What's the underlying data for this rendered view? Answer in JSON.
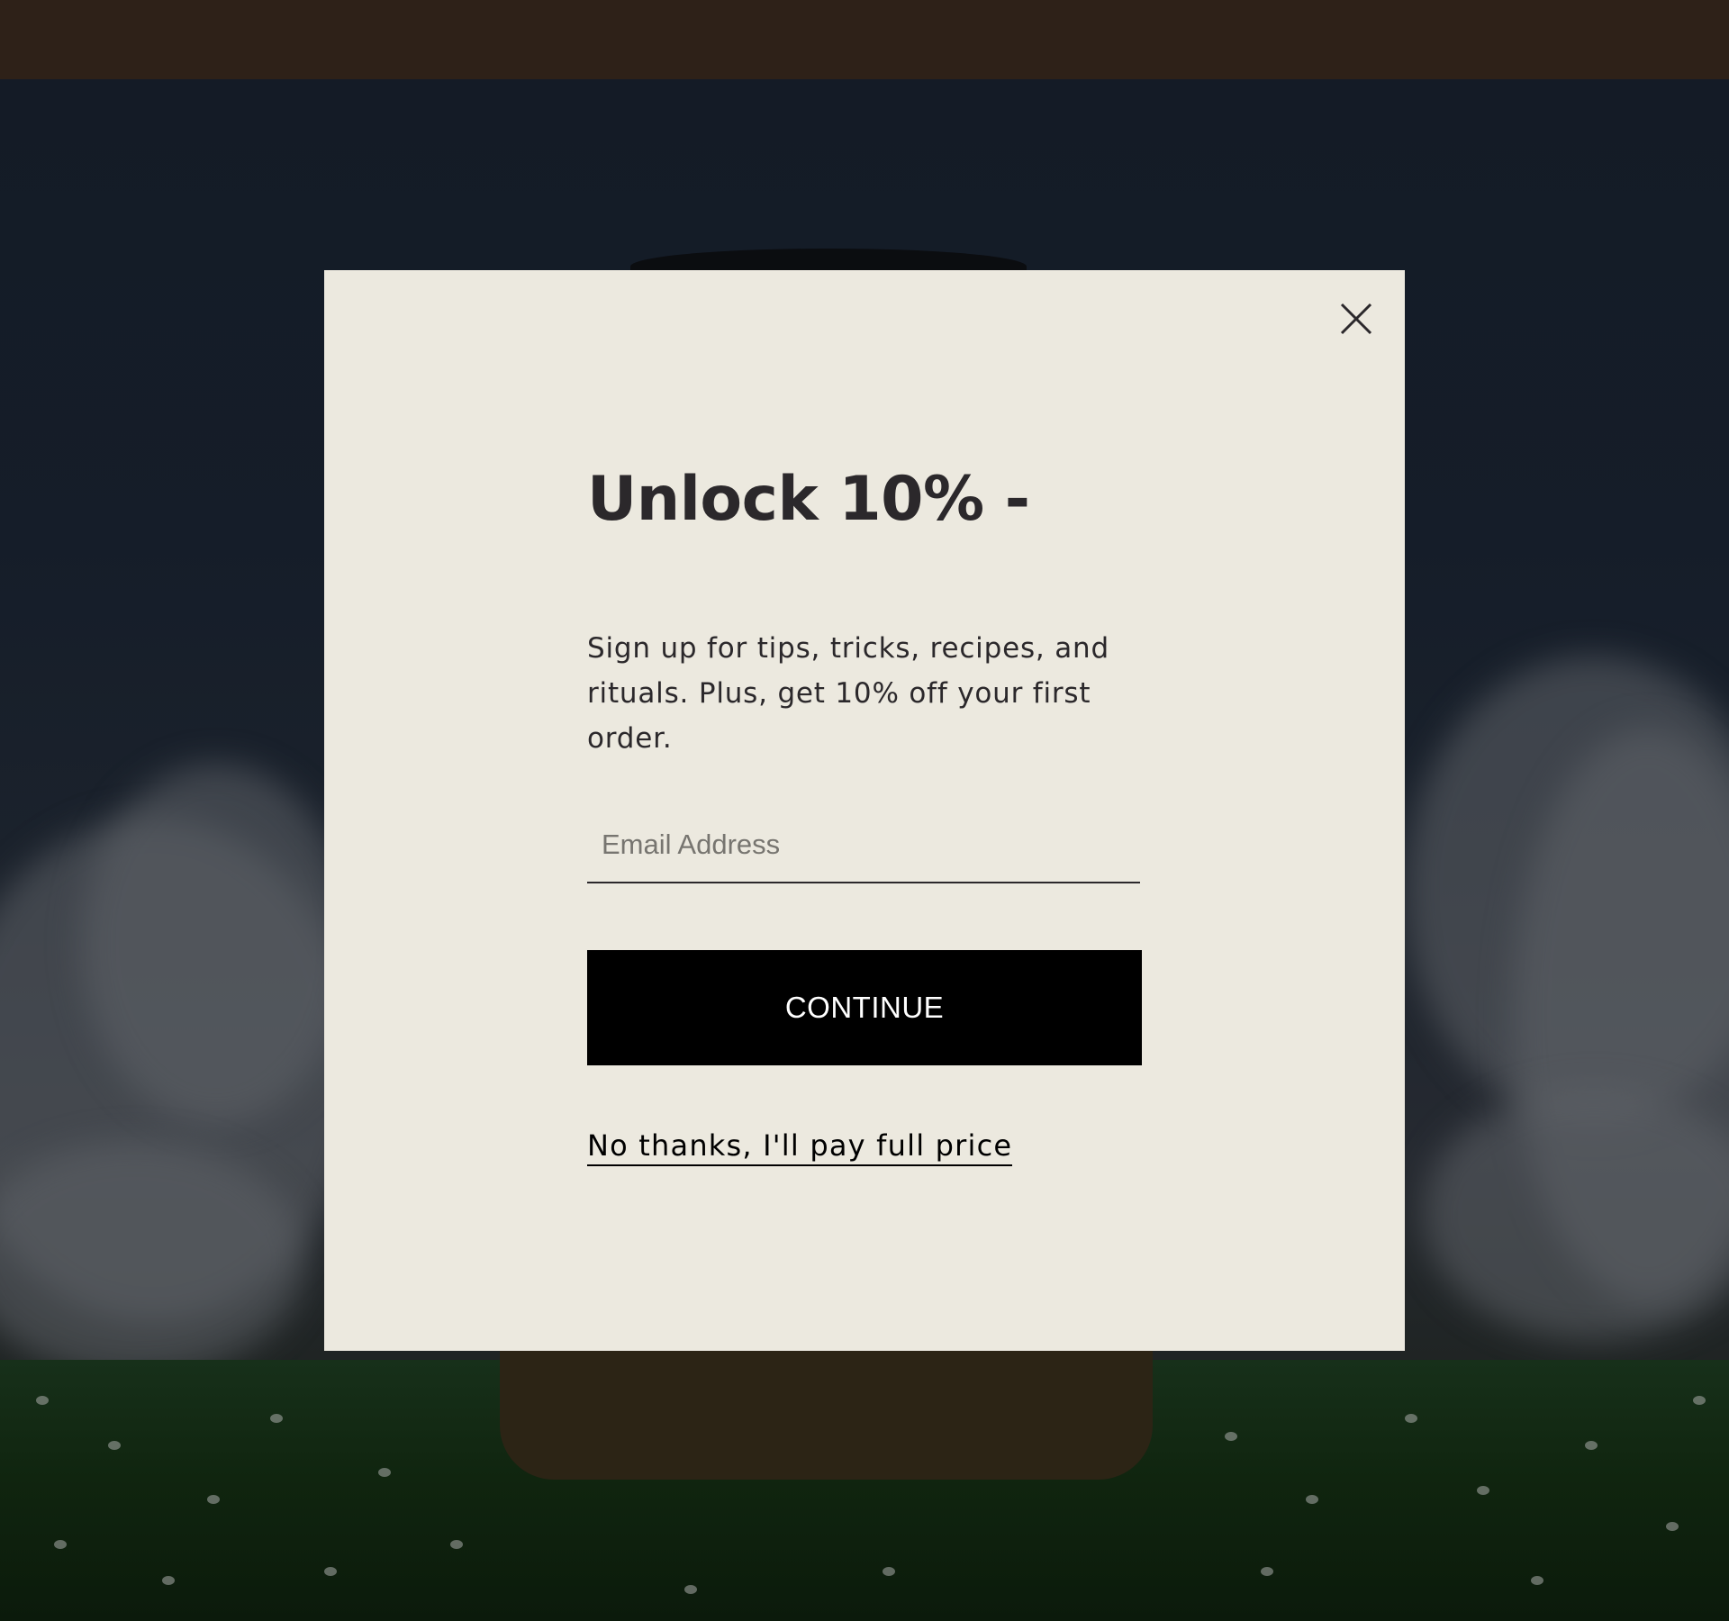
{
  "popup": {
    "close_icon": "close-icon",
    "headline": "Unlock 10% -",
    "body": "Sign up for tips, tricks, recipes, and rituals. Plus, get 10% off your first order.",
    "email": {
      "placeholder": "Email Address",
      "value": ""
    },
    "continue_label": "CONTINUE",
    "decline_label": "No thanks, I'll pay full price"
  },
  "colors": {
    "header_bar": "#2e2118",
    "modal_background": "#ece9df",
    "text": "#2b282b",
    "button_background": "#000000",
    "button_text": "#ffffff"
  }
}
